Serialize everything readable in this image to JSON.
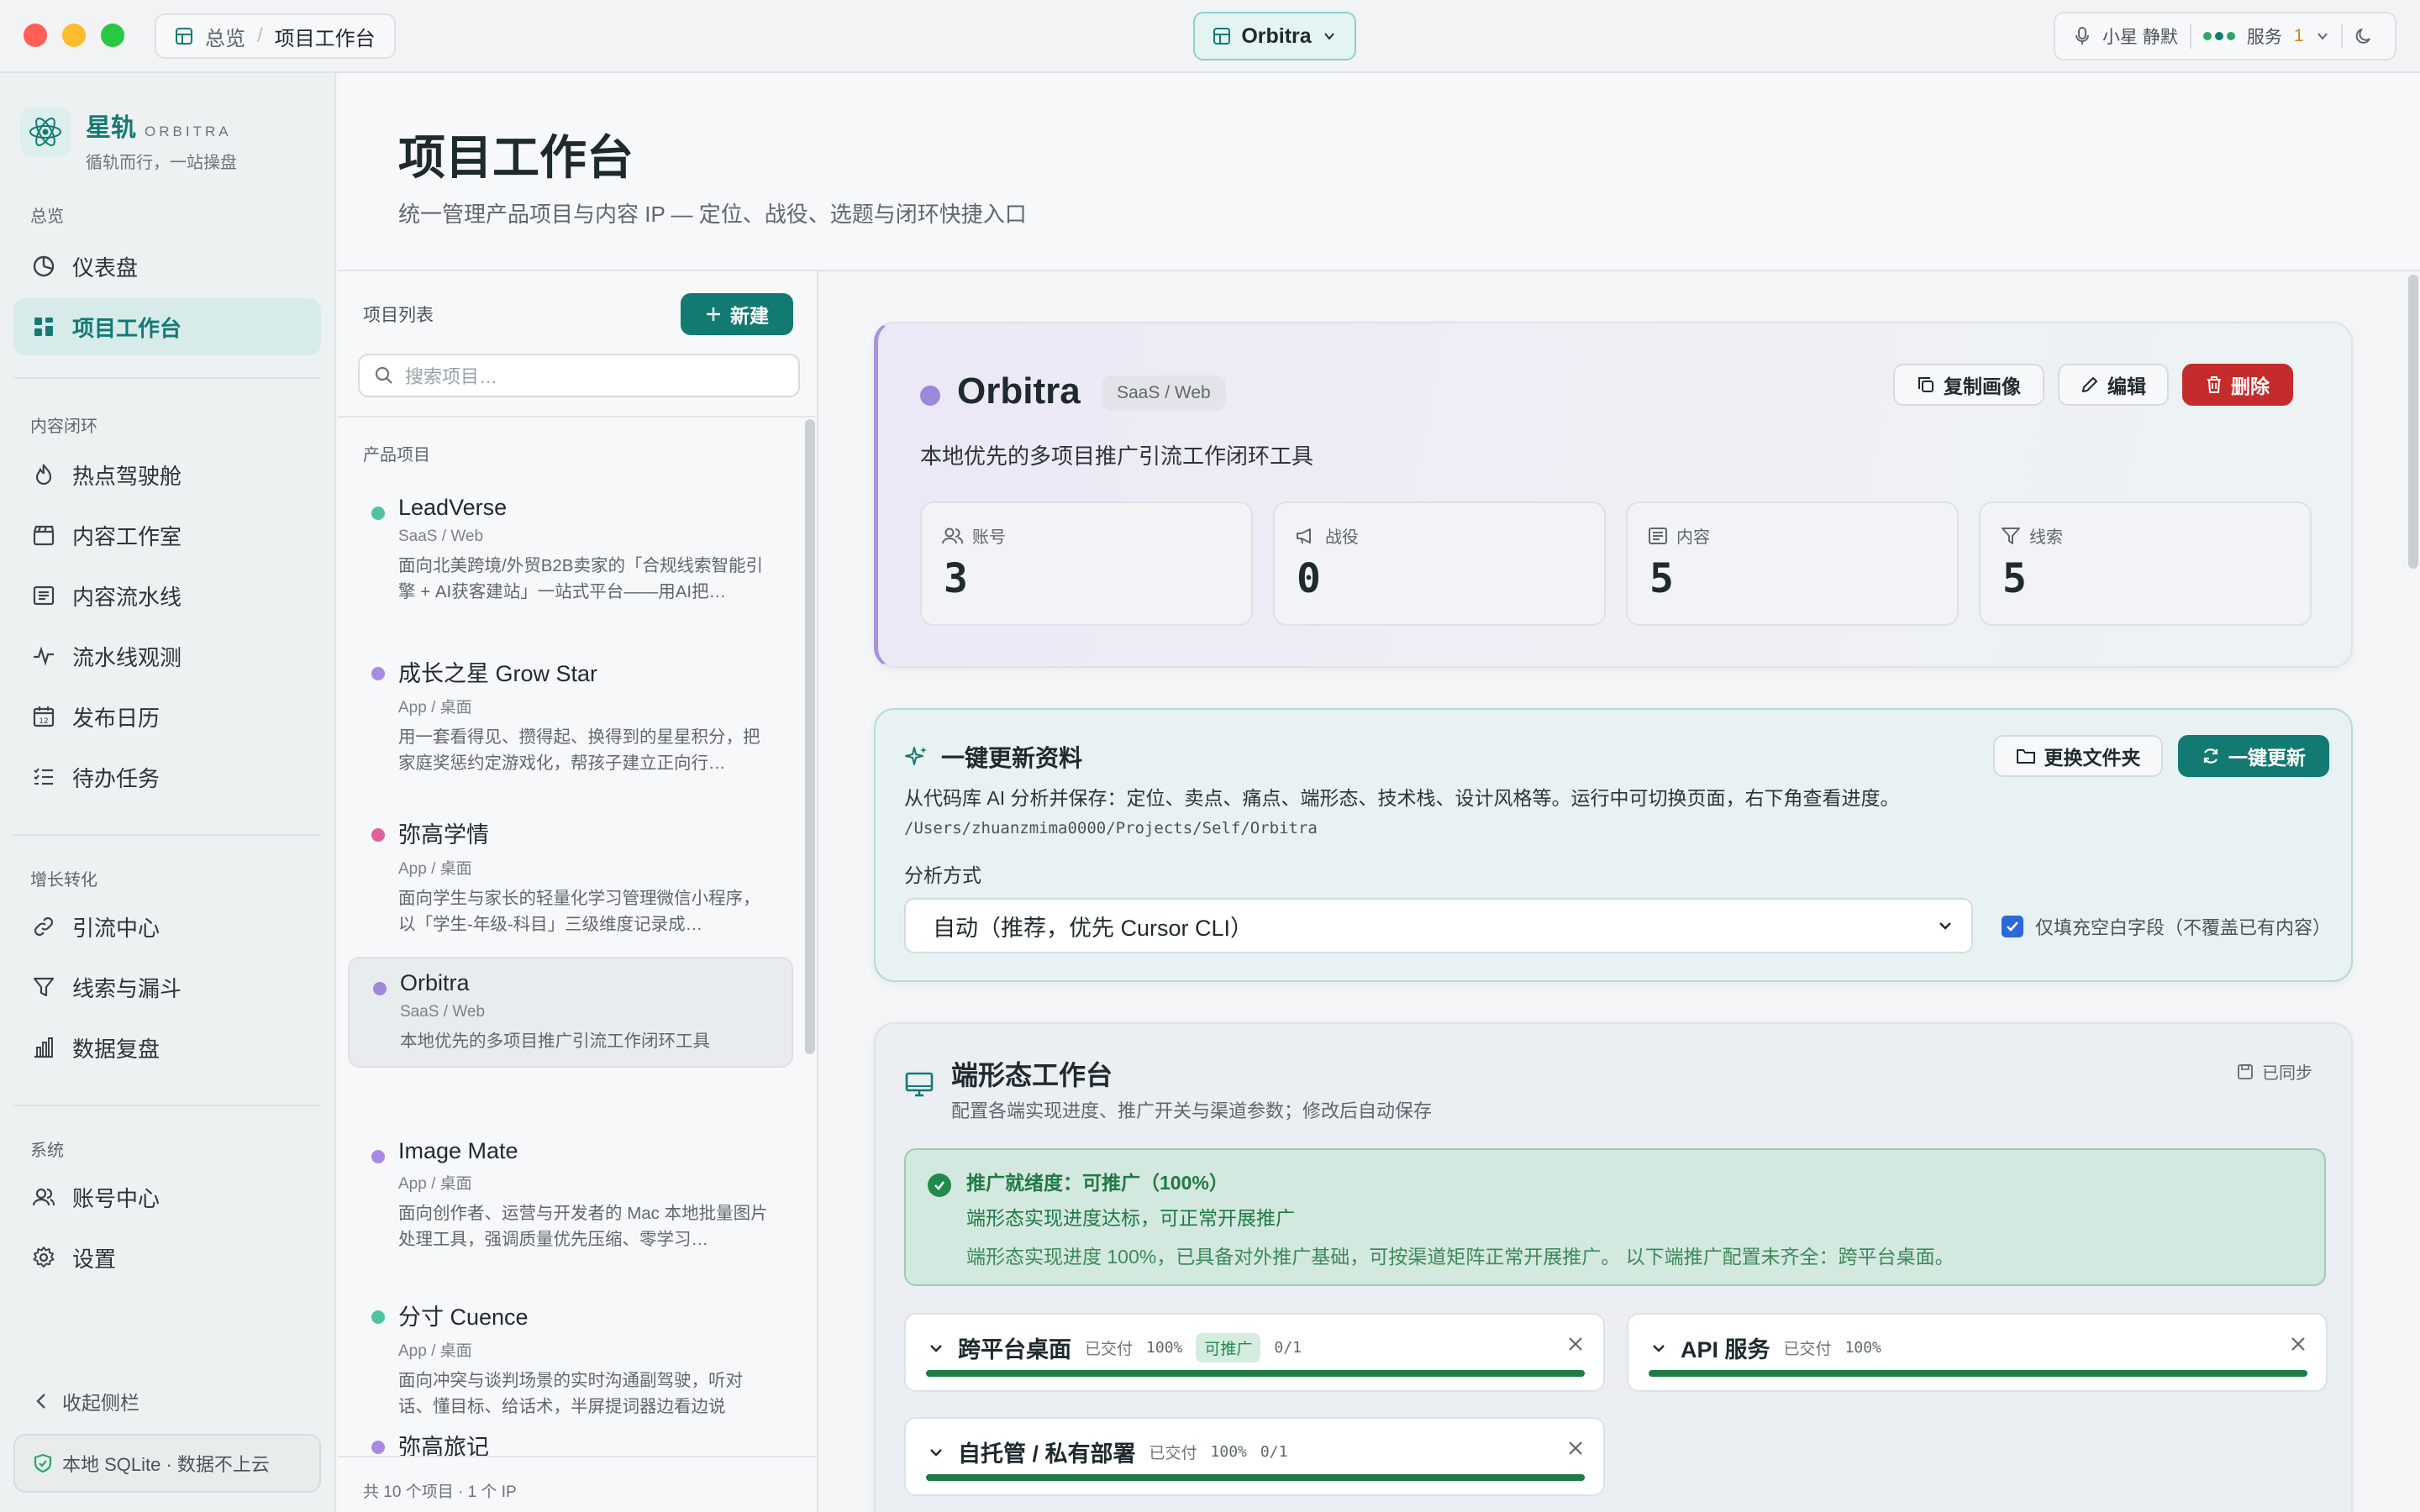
{
  "topbar": {
    "breadcrumb": [
      "总览",
      "项目工作台"
    ],
    "project_switch": "Orbitra",
    "voice_status": "小星 静默",
    "service_label": "服务",
    "service_count": "1",
    "colors": {
      "accent": "#137a72",
      "dot_green": "#2fa36b",
      "dot_yellow": "#e0a31a",
      "dot_teal": "#137a72"
    }
  },
  "sidebar": {
    "brand": {
      "name": "星轨",
      "sub": "ORBITRA",
      "slogan": "循轨而行，一站操盘"
    },
    "sections": [
      {
        "title": "总览",
        "items": [
          {
            "label": "仪表盘",
            "icon": "dashboard-icon"
          },
          {
            "label": "项目工作台",
            "icon": "grid-icon",
            "active": true
          }
        ]
      },
      {
        "title": "内容闭环",
        "items": [
          {
            "label": "热点驾驶舱",
            "icon": "flame-icon"
          },
          {
            "label": "内容工作室",
            "icon": "clapperboard-icon"
          },
          {
            "label": "内容流水线",
            "icon": "list-icon"
          },
          {
            "label": "流水线观测",
            "icon": "activity-icon"
          },
          {
            "label": "发布日历",
            "icon": "calendar-icon"
          },
          {
            "label": "待办任务",
            "icon": "checklist-icon"
          }
        ]
      },
      {
        "title": "增长转化",
        "items": [
          {
            "label": "引流中心",
            "icon": "link-icon"
          },
          {
            "label": "线索与漏斗",
            "icon": "funnel-icon"
          },
          {
            "label": "数据复盘",
            "icon": "bar-chart-icon"
          }
        ]
      },
      {
        "title": "系统",
        "items": [
          {
            "label": "账号中心",
            "icon": "users-icon"
          },
          {
            "label": "设置",
            "icon": "gear-icon"
          }
        ]
      }
    ],
    "collapse_label": "收起侧栏",
    "db_label": "本地 SQLite · 数据不上云"
  },
  "header": {
    "title": "项目工作台",
    "subtitle": "统一管理产品项目与内容 IP — 定位、战役、选题与闭环快捷入口"
  },
  "project_list": {
    "title": "项目列表",
    "new_label": "新建",
    "search_placeholder": "搜索项目…",
    "section_label": "产品项目",
    "items": [
      {
        "name": "LeadVerse",
        "category": "SaaS / Web",
        "desc": "面向北美跨境/外贸B2B卖家的「合规线索智能引擎 + AI获客建站」一站式平台——用AI把…",
        "color": "#4fc3a1"
      },
      {
        "name": "成长之星 Grow Star",
        "category": "App / 桌面",
        "desc": "用一套看得见、攒得起、换得到的星星积分，把家庭奖惩约定游戏化，帮孩子建立正向行…",
        "color": "#a88be0"
      },
      {
        "name": "弥高学情",
        "category": "App / 桌面",
        "desc": "面向学生与家长的轻量化学习管理微信小程序，以「学生-年级-科目」三级维度记录成…",
        "color": "#e0609a"
      },
      {
        "name": "Orbitra",
        "category": "SaaS / Web",
        "desc": "本地优先的多项目推广引流工作闭环工具",
        "color": "#9d87d9",
        "selected": true
      },
      {
        "name": "Image Mate",
        "category": "App / 桌面",
        "desc": "面向创作者、运营与开发者的 Mac 本地批量图片处理工具，强调质量优先压缩、零学习…",
        "color": "#a88be0"
      },
      {
        "name": "分寸 Cuence",
        "category": "App / 桌面",
        "desc": "面向冲突与谈判场景的实时沟通副驾驶，听对话、懂目标、给话术，半屏提词器边看边说",
        "color": "#4fc3a1"
      },
      {
        "name": "弥高旅记",
        "category": "",
        "desc": "",
        "color": "#a88be0"
      }
    ],
    "footer": "共 10 个项目 · 1 个 IP"
  },
  "project": {
    "name": "Orbitra",
    "tag": "SaaS / Web",
    "desc": "本地优先的多项目推广引流工作闭环工具",
    "actions": {
      "copy": "复制画像",
      "edit": "编辑",
      "delete": "删除"
    },
    "stats": [
      {
        "label": "账号",
        "value": "3",
        "icon": "users-icon"
      },
      {
        "label": "战役",
        "value": "0",
        "icon": "megaphone-icon"
      },
      {
        "label": "内容",
        "value": "5",
        "icon": "document-icon"
      },
      {
        "label": "线索",
        "value": "5",
        "icon": "funnel-icon"
      }
    ]
  },
  "update": {
    "title": "一键更新资料",
    "desc": "从代码库 AI 分析并保存：定位、卖点、痛点、端形态、技术栈、设计风格等。运行中可切换页面，右下角查看进度。",
    "path": "/Users/zhuanzmima0000/Projects/Self/Orbitra",
    "method_label": "分析方式",
    "method_value": "自动（推荐，优先 Cursor CLI）",
    "checkbox_label": "仅填充空白字段（不覆盖已有内容）",
    "btn_folder": "更换文件夹",
    "btn_update": "一键更新"
  },
  "terminal": {
    "title": "端形态工作台",
    "desc": "配置各端实现进度、推广开关与渠道参数；修改后自动保存",
    "sync": "已同步",
    "ready_title": "推广就绪度：可推广（100%）",
    "ready_line1": "端形态实现进度达标，可正常开展推广",
    "ready_line2": "端形态实现进度 100%，已具备对外推广基础，可按渠道矩阵正常开展推广。 以下端推广配置未齐全：跨平台桌面。",
    "platforms": [
      {
        "name": "跨平台桌面",
        "status": "已交付",
        "pct": "100%",
        "badge": "可推广",
        "count": "0/1",
        "progress": 1.0
      },
      {
        "name": "API 服务",
        "status": "已交付",
        "pct": "100%",
        "badge": "",
        "count": "",
        "progress": 1.0
      },
      {
        "name": "自托管 / 私有部署",
        "status": "已交付",
        "pct": "100%",
        "badge": "",
        "count": "0/1",
        "progress": 1.0
      }
    ]
  }
}
